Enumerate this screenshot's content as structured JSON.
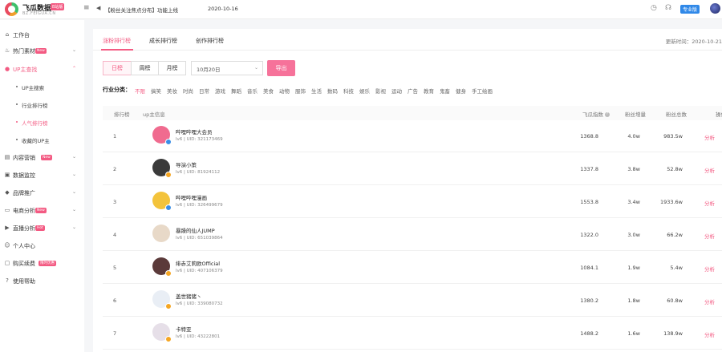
{
  "header": {
    "brand": "飞瓜数据",
    "brand_tag": "B站版",
    "brand_url": "BZ.FEIGUA.CN",
    "notice": "【粉丝关注焦点分布】功能上线",
    "notice_date": "2020-10-16",
    "pro_label": "专业版"
  },
  "sidebar": {
    "items": [
      {
        "label": "工作台",
        "icon": "home-icon"
      },
      {
        "label": "热门素材",
        "icon": "fire-icon",
        "badge": "New"
      },
      {
        "label": "UP主查找",
        "icon": "user-search-icon"
      },
      {
        "label": "内容营销",
        "icon": "content-icon",
        "badge": "New"
      },
      {
        "label": "数据监控",
        "icon": "monitor-icon"
      },
      {
        "label": "品牌推广",
        "icon": "brand-icon"
      },
      {
        "label": "电商分析",
        "icon": "cart-icon",
        "badge": "New"
      },
      {
        "label": "直播分析",
        "icon": "live-icon",
        "badge": "Hot"
      },
      {
        "label": "个人中心",
        "icon": "person-icon"
      },
      {
        "label": "购买续费",
        "icon": "buy-icon",
        "badge": "限时优惠"
      },
      {
        "label": "使用帮助",
        "icon": "help-icon"
      }
    ],
    "sub_items": [
      {
        "label": "UP主搜索"
      },
      {
        "label": "行业排行榜"
      },
      {
        "label": "人气排行榜"
      },
      {
        "label": "收藏的UP主"
      }
    ]
  },
  "tabs": [
    "涨粉排行榜",
    "成长排行榜",
    "创作排行榜"
  ],
  "update_time": "更新时间：2020-10-21",
  "period": [
    "日榜",
    "周榜",
    "月榜"
  ],
  "date_value": "10月20日",
  "export_label": "导出",
  "category_label": "行业分类：",
  "categories": [
    "不限",
    "搞笑",
    "美妆",
    "时尚",
    "日常",
    "游戏",
    "舞蹈",
    "音乐",
    "美食",
    "动物",
    "服饰",
    "生活",
    "数码",
    "科技",
    "娱乐",
    "影视",
    "运动",
    "广告",
    "教育",
    "鬼畜",
    "健身",
    "手工绘画"
  ],
  "table": {
    "headers": [
      "排行榜",
      "up主信息",
      "飞瓜指数",
      "粉丝增量",
      "粉丝总数",
      "操作"
    ],
    "rows": [
      {
        "rank": "1",
        "name": "哔哩哔哩大会员",
        "sub": "lv6 | UID: 321173469",
        "index": "1368.8",
        "inc": "4.0w",
        "total": "983.5w",
        "action": "分析",
        "avatar": "#f06b8f",
        "badge": "#3a8ee6"
      },
      {
        "rank": "2",
        "name": "导演小策",
        "sub": "lv6 | UID: 81924112",
        "index": "1337.8",
        "inc": "3.8w",
        "total": "52.8w",
        "action": "分析",
        "avatar": "#3a3a3a",
        "badge": "#f5a623"
      },
      {
        "rank": "3",
        "name": "哔哩哔哩漫画",
        "sub": "lv6 | UID: 326499679",
        "index": "1553.8",
        "inc": "3.4w",
        "total": "1933.6w",
        "action": "分析",
        "avatar": "#f3c33b",
        "badge": "#3a8ee6"
      },
      {
        "rank": "4",
        "name": "暴躁的仙人JUMP",
        "sub": "lv6 | UID: 651039864",
        "index": "1322.0",
        "inc": "3.0w",
        "total": "66.2w",
        "action": "分析",
        "avatar": "#e8d9c8",
        "badge": ""
      },
      {
        "rank": "5",
        "name": "绯赤艾莉欧Official",
        "sub": "lv6 | UID: 407106379",
        "index": "1084.1",
        "inc": "1.9w",
        "total": "5.4w",
        "action": "分析",
        "avatar": "#5b3a3a",
        "badge": "#f5a623"
      },
      {
        "rank": "6",
        "name": "盖世猪猪丶",
        "sub": "lv6 | UID: 339080732",
        "index": "1380.2",
        "inc": "1.8w",
        "total": "60.8w",
        "action": "分析",
        "avatar": "#e9eef5",
        "badge": "#f5a623"
      },
      {
        "rank": "7",
        "name": "卡特亚",
        "sub": "lv6 | UID: 43222801",
        "index": "1488.2",
        "inc": "1.6w",
        "total": "138.9w",
        "action": "分析",
        "avatar": "#e6dfe8",
        "badge": "#f5a623"
      }
    ]
  }
}
